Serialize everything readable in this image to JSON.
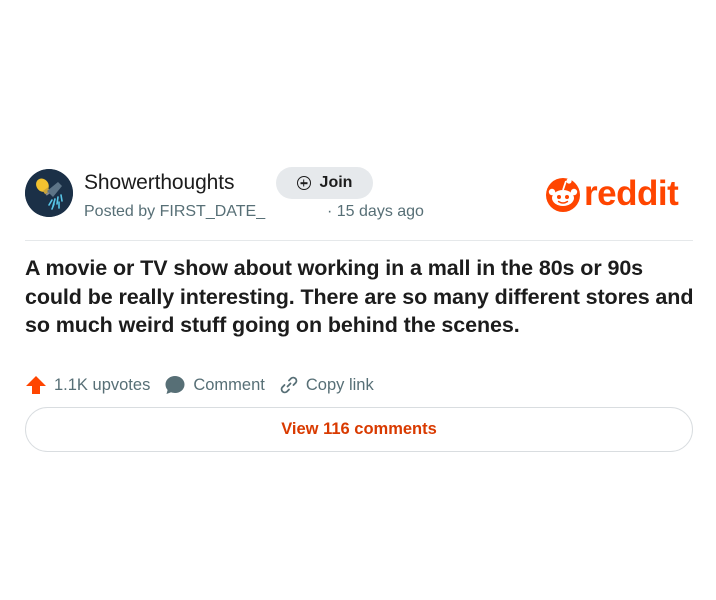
{
  "post": {
    "subreddit": "Showerthoughts",
    "join_label": "Join",
    "posted_by": "Posted by FIRST_DATE_",
    "time_ago": "· 15 days ago",
    "title": "A movie or TV show about working in a mall in the 80s or 90s could be really interesting. There are so many different stores and so much weird stuff going on behind the scenes.",
    "upvotes_label": "1.1K upvotes",
    "comment_label": "Comment",
    "copy_link_label": "Copy link",
    "view_comments_label": "View 116 comments"
  },
  "brand": {
    "logo_text": "reddit",
    "accent_color": "#ff4500",
    "link_color": "#d93a00"
  },
  "icons": {
    "avatar": "showerhead-lightbulb-icon",
    "join": "plus-circle-icon",
    "upvote": "upvote-arrow-icon",
    "comment": "speech-bubble-icon",
    "copy_link": "link-icon",
    "brand": "reddit-snoo-icon"
  }
}
